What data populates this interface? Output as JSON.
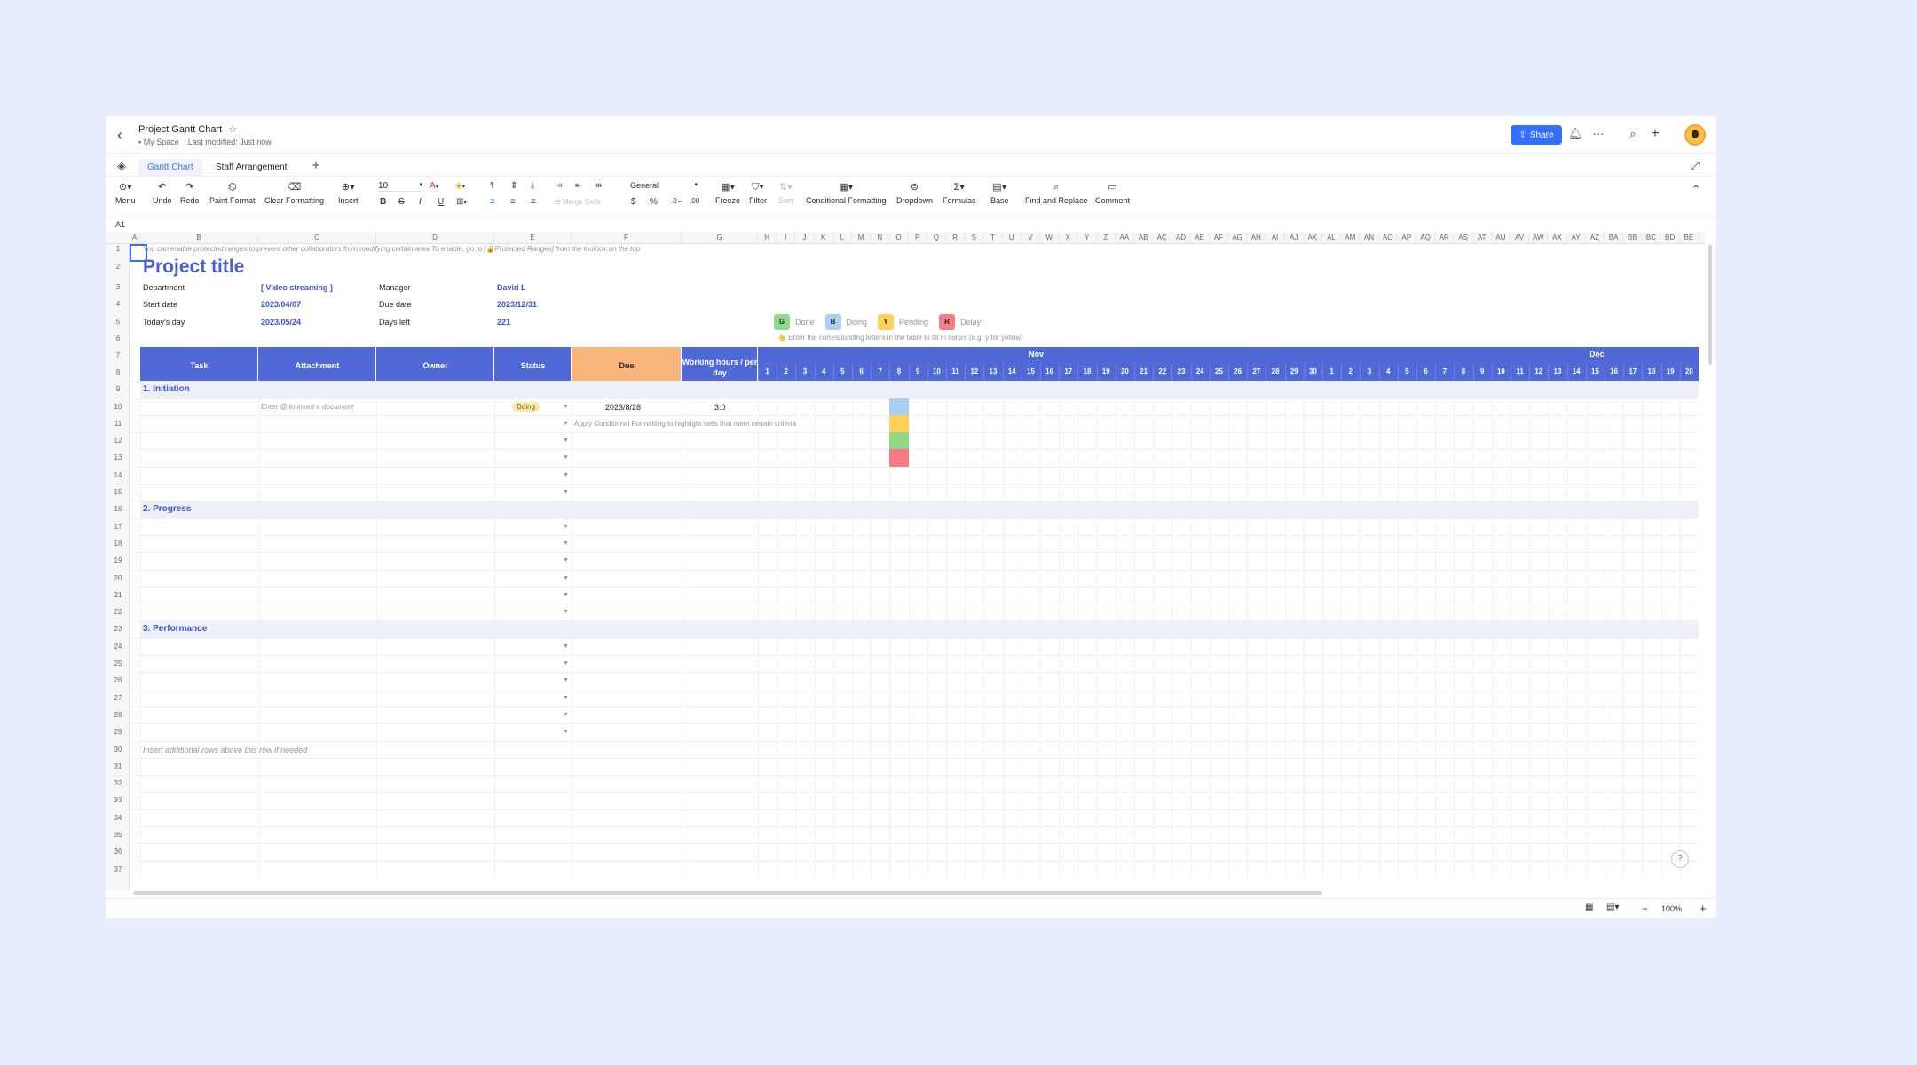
{
  "header": {
    "doc_title": "Project Gantt Chart",
    "space": "My Space",
    "last_modified": "Last modified: Just now",
    "share_label": "Share"
  },
  "tabs": [
    "Gantt Chart",
    "Staff Arrangement"
  ],
  "toolbar": {
    "menu": "Menu",
    "undo": "Undo",
    "redo": "Redo",
    "paint_format": "Paint Format",
    "clear_formatting": "Clear Formatting",
    "insert": "Insert",
    "font_size": "10",
    "number_format": "General",
    "merge_cells": "Merge Cells",
    "freeze": "Freeze",
    "filter": "Filter",
    "sort": "Sort",
    "conditional_formatting": "Conditional Formatting",
    "dropdown": "Dropdown",
    "formulas": "Formulas",
    "base": "Base",
    "find_replace": "Find and Replace",
    "comment": "Comment"
  },
  "cell_ref": "A1",
  "columns": [
    "A",
    "B",
    "C",
    "D",
    "E",
    "F",
    "G",
    "H",
    "I",
    "J",
    "K",
    "L",
    "M",
    "N",
    "O",
    "P",
    "Q",
    "R",
    "S",
    "T",
    "U",
    "V",
    "W",
    "X",
    "Y",
    "Z",
    "AA",
    "AB",
    "AC",
    "AD",
    "AE",
    "AF",
    "AG",
    "AH",
    "AI",
    "AJ",
    "AK",
    "AL",
    "AM",
    "AN",
    "AO",
    "AP",
    "AQ",
    "AR",
    "AS",
    "AT",
    "AU",
    "AV",
    "AW",
    "AX",
    "AY",
    "AZ",
    "BA",
    "BB",
    "BC",
    "BD",
    "BE"
  ],
  "sheet": {
    "notice": "You can enable protected ranges to prevent other collaborators from modifying certain area To enable, go to [🔒Protected Ranges] from the toolbox on the top",
    "project_title": "Project title",
    "department_label": "Department",
    "department_value": "[ Video streaming ]",
    "manager_label": "Manager",
    "manager_value": "David L",
    "start_label": "Start date",
    "start_value": "2023/04/07",
    "due_label": "Due date",
    "due_value": "2023/12/31",
    "today_label": "Today's day",
    "today_value": "2023/05/24",
    "days_left_label": "Days left",
    "days_left_value": "221",
    "legend": [
      {
        "letter": "G",
        "label": "Done",
        "color": "#8fd988"
      },
      {
        "letter": "B",
        "label": "Doing",
        "color": "#a9cff5"
      },
      {
        "letter": "Y",
        "label": "Pending",
        "color": "#ffd257"
      },
      {
        "letter": "R",
        "label": "Delay",
        "color": "#f77b86"
      }
    ],
    "legend_hint": "Enter the corresponding letters in the table to fill in colors (e.g. y for yellow)",
    "table_headers": {
      "task": "Task",
      "attachment": "Attachment",
      "owner": "Owner",
      "status": "Status",
      "due": "Due",
      "hours": "Working hours / per day"
    },
    "months": [
      "Nov",
      "Dec"
    ],
    "nov_days": [
      "1",
      "2",
      "3",
      "4",
      "5",
      "6",
      "7",
      "8",
      "9",
      "10",
      "11",
      "12",
      "13",
      "14",
      "15",
      "16",
      "17",
      "18",
      "19",
      "20",
      "21",
      "22",
      "23",
      "24",
      "25",
      "26",
      "27",
      "28",
      "29",
      "30"
    ],
    "dec_days": [
      "1",
      "2",
      "3",
      "4",
      "5",
      "6",
      "7",
      "8",
      "9",
      "10",
      "11",
      "12",
      "13",
      "14",
      "15",
      "16",
      "17",
      "18",
      "19",
      "20"
    ],
    "sections": [
      "1. Initiation",
      "2. Progress",
      "3. Performance"
    ],
    "row10": {
      "attachment_hint": "Enter @ to insert a document",
      "status": "Doing",
      "due": "2023/8/28",
      "hours": "3.0"
    },
    "row11_hint": "Apply Conditional Formatting to highlight cells that meet certain criteria",
    "footer_hint": "Insert additional rows above this row if needed",
    "gantt_cells": [
      {
        "row": 10,
        "color": "#a9cff5"
      },
      {
        "row": 11,
        "color": "#ffd257"
      },
      {
        "row": 12,
        "color": "#8fd988"
      },
      {
        "row": 13,
        "color": "#f77b86"
      }
    ],
    "colors": {
      "header_blue": "#5069d6",
      "due_orange": "#f7b57c",
      "band": "#eef0f8",
      "accent": "#3370ff"
    }
  },
  "status_bar": {
    "zoom": "100%"
  }
}
